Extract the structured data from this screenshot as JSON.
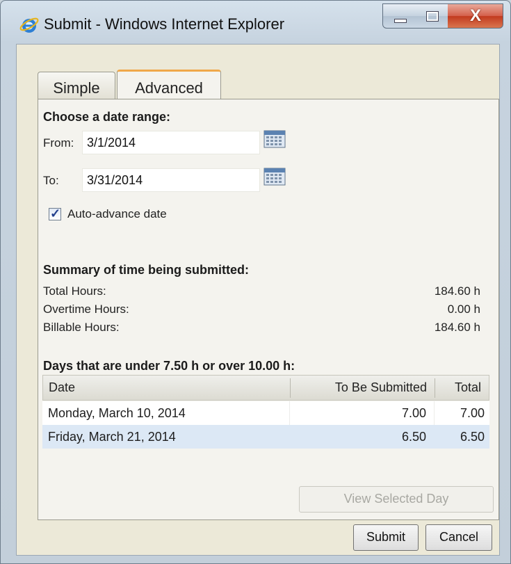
{
  "window": {
    "title": "Submit - Windows Internet Explorer",
    "close_glyph": "X"
  },
  "tabs": [
    {
      "label": "Simple",
      "active": false
    },
    {
      "label": "Advanced",
      "active": true
    }
  ],
  "date_range": {
    "heading": "Choose a date range:",
    "from_label": "From:",
    "from_value": "3/1/2014",
    "to_label": "To:",
    "to_value": "3/31/2014",
    "auto_advance_label": "Auto-advance date",
    "auto_advance_checked": true
  },
  "summary": {
    "heading": "Summary of time being submitted:",
    "rows": [
      {
        "label": "Total Hours:",
        "value": "184.60 h"
      },
      {
        "label": "Overtime Hours:",
        "value": "0.00 h"
      },
      {
        "label": "Billable Hours:",
        "value": "184.60 h"
      }
    ]
  },
  "days": {
    "heading": "Days that are under 7.50 h or over 10.00 h:",
    "columns": [
      "Date",
      "To Be Submitted",
      "Total"
    ],
    "rows": [
      {
        "date": "Monday, March 10, 2014",
        "to_be_submitted": "7.00",
        "total": "7.00",
        "selected": false
      },
      {
        "date": "Friday, March 21, 2014",
        "to_be_submitted": "6.50",
        "total": "6.50",
        "selected": true
      }
    ]
  },
  "buttons": {
    "view_selected_day": "View Selected Day",
    "submit": "Submit",
    "cancel": "Cancel"
  },
  "colors": {
    "active_tab_accent": "#f0a84a",
    "selected_row": "#dce8f5",
    "close_button": "#c23a1f"
  }
}
